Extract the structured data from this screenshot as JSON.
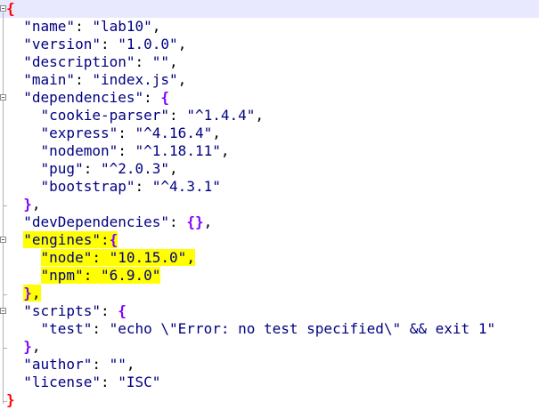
{
  "editor": {
    "language": "json",
    "highlight_color": "#ffff00",
    "lines": [
      "{",
      "  \"name\": \"lab10\",",
      "  \"version\": \"1.0.0\",",
      "  \"description\": \"\",",
      "  \"main\": \"index.js\",",
      "  \"dependencies\": {",
      "    \"cookie-parser\": \"^1.4.4\",",
      "    \"express\": \"^4.16.4\",",
      "    \"nodemon\": \"^1.18.11\",",
      "    \"pug\": \"^2.0.3\",",
      "    \"bootstrap\": \"^4.3.1\"",
      "  },",
      "  \"devDependencies\": {},",
      "  \"engines\":{",
      "    \"node\": \"10.15.0\",",
      "    \"npm\": \"6.9.0\"",
      "  },",
      "  \"scripts\": {",
      "    \"test\": \"echo \\\"Error: no test specified\\\" && exit 1\"",
      "  },",
      "  \"author\": \"\",",
      "  \"license\": \"ISC\"",
      "}"
    ]
  }
}
